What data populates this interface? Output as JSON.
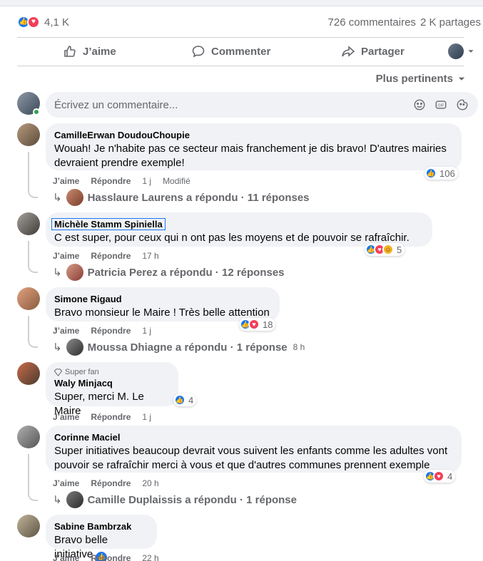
{
  "post_stats": {
    "reaction_count": "4,1 K",
    "comments": "726 commentaires",
    "shares": "2 K partages"
  },
  "actions": {
    "like": "J’aime",
    "comment": "Commenter",
    "share": "Partager"
  },
  "sort": {
    "label": "Plus pertinents"
  },
  "composer": {
    "placeholder": "Écrivez un commentaire..."
  },
  "comments": [
    {
      "author": "CamilleErwan DoudouChoupie",
      "text": "Wouah! Je n'habite pas ce secteur mais franchement je dis bravo! D'autres mairies devraient prendre exemple!",
      "reactions": "106",
      "like": "J’aime",
      "reply": "Répondre",
      "time": "1 j",
      "edited": "Modifié",
      "replies": "Hasslaure Laurens a répondu · 11 réponses"
    },
    {
      "author": "Michèle Stamm Spiniella",
      "text": "C est super, pour ceux qui n ont pas les moyens et de pouvoir se rafraîchir.",
      "reactions": "5",
      "like": "J’aime",
      "reply": "Répondre",
      "time": "17 h",
      "replies": "Patricia Perez a répondu · 12 réponses"
    },
    {
      "author": "Simone Rigaud",
      "text": "Bravo monsieur le Maire ! Très belle attention .",
      "reactions": "18",
      "like": "J’aime",
      "reply": "Répondre",
      "time": "1 j",
      "replies": "Moussa Dhiagne a répondu · 1 réponse",
      "replies_time": "8 h"
    },
    {
      "badge": "Super fan",
      "author": "Waly Minjacq",
      "text": "Super, merci M. Le Maire",
      "reactions": "4",
      "like": "J’aime",
      "reply": "Répondre",
      "time": "1 j"
    },
    {
      "author": "Corinne Maciel",
      "text": "Super initiatives beaucoup devrait vous suivent les enfants comme les adultes vont pouvoir se rafraîchir merci à vous et que d'autres communes prennent exemple",
      "reactions": "4",
      "like": "J’aime",
      "reply": "Répondre",
      "time": "20 h",
      "replies": "Camille Duplaissis a répondu · 1 réponse"
    },
    {
      "author": "Sabine Bambrzak",
      "text": "Bravo belle initiative",
      "like": "J’aime",
      "reply": "Répondre",
      "time": "22 h"
    }
  ],
  "colors": {
    "like": "#1877f2",
    "love": "#f33e58",
    "haha": "#f7b125",
    "bubble": "#f0f2f5",
    "secondary_text": "#65676b"
  }
}
